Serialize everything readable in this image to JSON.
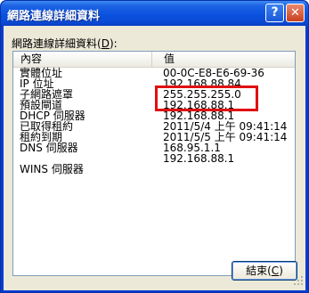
{
  "window": {
    "title": "網路連線詳細資料",
    "help_label": "?",
    "close_label": "✕"
  },
  "list": {
    "label_text": "網路連線詳細資料(",
    "label_mnemonic": "D",
    "label_suffix": "):",
    "columns": [
      "內容",
      "值"
    ],
    "rows": [
      {
        "prop": "實體位址",
        "val": "00-0C-E8-E6-69-36"
      },
      {
        "prop": "IP 位址",
        "val": "192.168.88.84"
      },
      {
        "prop": "子網路遮罩",
        "val": "255.255.255.0"
      },
      {
        "prop": "預設閘道",
        "val": "192.168.88.1"
      },
      {
        "prop": "DHCP 伺服器",
        "val": "192.168.88.1"
      },
      {
        "prop": "已取得租約",
        "val": "2011/5/4 上午 09:41:14"
      },
      {
        "prop": "租約到期",
        "val": "2011/5/5 上午 09:41:14"
      },
      {
        "prop": "DNS 伺服器",
        "val": "168.95.1.1"
      },
      {
        "prop": "",
        "val": "192.168.88.1"
      },
      {
        "prop": "WINS 伺服器",
        "val": ""
      }
    ]
  },
  "footer": {
    "close_button": "結束(",
    "close_mnemonic": "C",
    "close_suffix": ")"
  },
  "colors": {
    "title_bar": "#0a52df",
    "dialog_bg": "#ece9d8",
    "highlight": "#e01010"
  }
}
